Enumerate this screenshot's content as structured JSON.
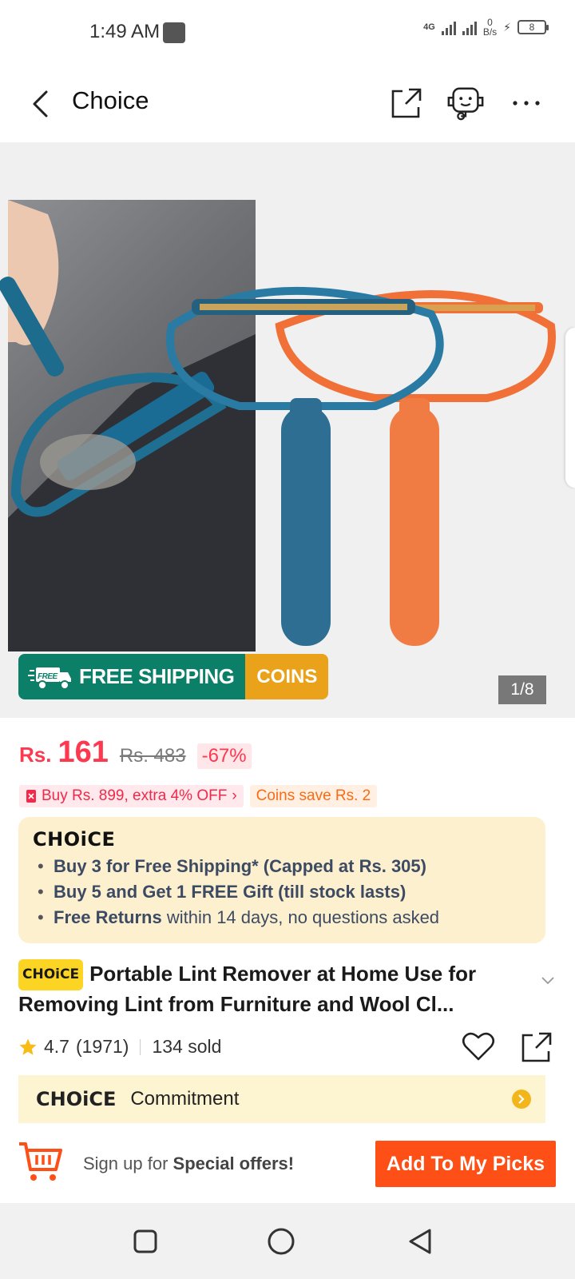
{
  "status_bar": {
    "time": "1:49 AM",
    "network": "4G",
    "speed_value": "0",
    "speed_unit": "B/s",
    "battery": "8"
  },
  "header": {
    "title": "Choice",
    "back_icon": "chevron-left-icon",
    "share_icon": "share-icon",
    "support_icon": "robot-support-icon",
    "more_icon": "more-horizontal-icon"
  },
  "gallery": {
    "free_shipping_label": "FREE SHIPPING",
    "free_tag": "FREE",
    "coins_label": "COINS",
    "page_counter": "1/8"
  },
  "price": {
    "currency": "Rs.",
    "current": "161",
    "original": "Rs. 483",
    "discount": "-67%"
  },
  "promos": {
    "deal": "Buy Rs. 899, extra 4% OFF",
    "coins": "Coins save Rs. 2"
  },
  "choice_box": {
    "logo": "CHOiCE",
    "items": [
      {
        "bold": "Buy 3 for  Free Shipping* (Capped at Rs. 305)",
        "rest": ""
      },
      {
        "bold": "Buy 5 and Get 1 FREE Gift (till stock lasts)",
        "rest": ""
      },
      {
        "bold": "Free Returns",
        "rest": " within 14 days, no questions asked"
      }
    ]
  },
  "product": {
    "badge": "CHOiCE",
    "title": "Portable Lint Remover at Home Use for Removing Lint from Furniture and Wool Cl...",
    "rating": "4.7",
    "reviews": "(1971)",
    "sold": "134 sold"
  },
  "commitment": {
    "logo": "CHOiCE",
    "label": "Commitment"
  },
  "action_bar": {
    "signup_prefix": "Sign up for ",
    "signup_bold": "Special offers!",
    "button": "Add To My Picks"
  },
  "colors": {
    "accent_red": "#fd384f",
    "cta_orange": "#fd4f16",
    "shipping_green": "#0b7f67",
    "coins_yellow": "#eaa21a",
    "choice_bg": "#fdf0cf"
  }
}
